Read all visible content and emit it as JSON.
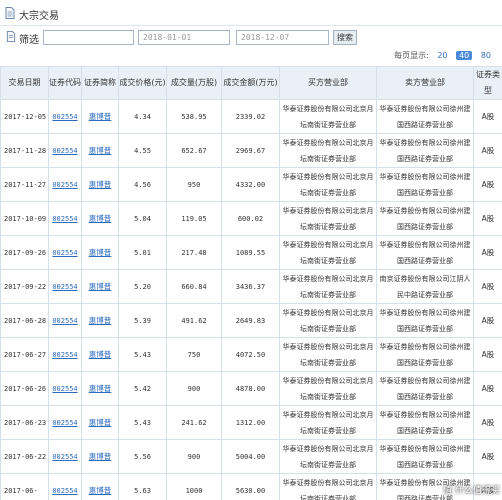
{
  "title": "大宗交易",
  "filter": {
    "label": "筛选",
    "query_value": "",
    "start_date": "2018-01-01",
    "end_date": "2018-12-07",
    "search_label": "搜索"
  },
  "pager": {
    "label": "每页显示:",
    "sizes": [
      "20",
      "40",
      "80"
    ],
    "active_size": "40"
  },
  "table": {
    "headers": [
      "交易日期",
      "证券代码",
      "证券简称",
      "成交价格(元)",
      "成交量(万股)",
      "成交金额(万元)",
      "买方营业部",
      "卖方营业部",
      "证券类型"
    ],
    "rows": [
      {
        "date": "2017-12-05",
        "code": "002554",
        "name": "惠博普",
        "price": "4.34",
        "volume": "538.95",
        "amount": "2339.02",
        "buyer": "华泰证券股份有限公司北京月坛南街证券营业部",
        "seller": "华泰证券股份有限公司徐州建国西路证券营业部",
        "type": "A股"
      },
      {
        "date": "2017-11-28",
        "code": "002554",
        "name": "惠博普",
        "price": "4.55",
        "volume": "652.67",
        "amount": "2969.67",
        "buyer": "华泰证券股份有限公司北京月坛南街证券营业部",
        "seller": "华泰证券股份有限公司徐州建国西路证券营业部",
        "type": "A股"
      },
      {
        "date": "2017-11-27",
        "code": "002554",
        "name": "惠博普",
        "price": "4.56",
        "volume": "950",
        "amount": "4332.00",
        "buyer": "华泰证券股份有限公司北京月坛南街证券营业部",
        "seller": "华泰证券股份有限公司徐州建国西路证券营业部",
        "type": "A股"
      },
      {
        "date": "2017-10-09",
        "code": "002554",
        "name": "惠博普",
        "price": "5.04",
        "volume": "119.05",
        "amount": "600.02",
        "buyer": "华泰证券股份有限公司北京月坛南街证券营业部",
        "seller": "华泰证券股份有限公司徐州建国西路证券营业部",
        "type": "A股"
      },
      {
        "date": "2017-09-26",
        "code": "002554",
        "name": "惠博普",
        "price": "5.01",
        "volume": "217.48",
        "amount": "1089.55",
        "buyer": "华泰证券股份有限公司北京月坛南街证券营业部",
        "seller": "华泰证券股份有限公司徐州建国西路证券营业部",
        "type": "A股"
      },
      {
        "date": "2017-09-22",
        "code": "002554",
        "name": "惠博普",
        "price": "5.20",
        "volume": "660.84",
        "amount": "3436.37",
        "buyer": "华泰证券股份有限公司北京月坛南街证券营业部",
        "seller": "南京证券股份有限公司江阴人民中路证券营业部",
        "type": "A股"
      },
      {
        "date": "2017-06-28",
        "code": "002554",
        "name": "惠博普",
        "price": "5.39",
        "volume": "491.62",
        "amount": "2649.83",
        "buyer": "华泰证券股份有限公司北京月坛南街证券营业部",
        "seller": "华泰证券股份有限公司徐州建国西路证券营业部",
        "type": "A股"
      },
      {
        "date": "2017-06-27",
        "code": "002554",
        "name": "惠博普",
        "price": "5.43",
        "volume": "750",
        "amount": "4072.50",
        "buyer": "华泰证券股份有限公司北京月坛南街证券营业部",
        "seller": "华泰证券股份有限公司徐州建国西路证券营业部",
        "type": "A股"
      },
      {
        "date": "2017-06-26",
        "code": "002554",
        "name": "惠博普",
        "price": "5.42",
        "volume": "900",
        "amount": "4878.00",
        "buyer": "华泰证券股份有限公司北京月坛南街证券营业部",
        "seller": "华泰证券股份有限公司徐州建国西路证券营业部",
        "type": "A股"
      },
      {
        "date": "2017-06-23",
        "code": "002554",
        "name": "惠博普",
        "price": "5.43",
        "volume": "241.62",
        "amount": "1312.00",
        "buyer": "华泰证券股份有限公司北京月坛南街证券营业部",
        "seller": "华泰证券股份有限公司徐州建国西路证券营业部",
        "type": "A股"
      },
      {
        "date": "2017-06-22",
        "code": "002554",
        "name": "惠博普",
        "price": "5.56",
        "volume": "900",
        "amount": "5004.00",
        "buyer": "华泰证券股份有限公司北京月坛南街证券营业部",
        "seller": "华泰证券股份有限公司徐州建国西路证券营业部",
        "type": "A股"
      },
      {
        "date": "2017-06-",
        "code": "002554",
        "name": "惠博普",
        "price": "5.63",
        "volume": "1000",
        "amount": "5630.00",
        "buyer": "华泰证券股份有限公司北京月坛南街证券营业部",
        "seller": "华泰证券股份有限公司徐州建国西路证券营业部",
        "type": "A股"
      }
    ]
  },
  "watermark": "值 什么值得买",
  "colors": {
    "header_bg": "#e9f0f7",
    "link": "#2c6dbd",
    "grid": "#d7dfe8",
    "active_page": "#4a8ad8"
  },
  "icons": {
    "title": "document-icon",
    "filter": "document-icon"
  }
}
